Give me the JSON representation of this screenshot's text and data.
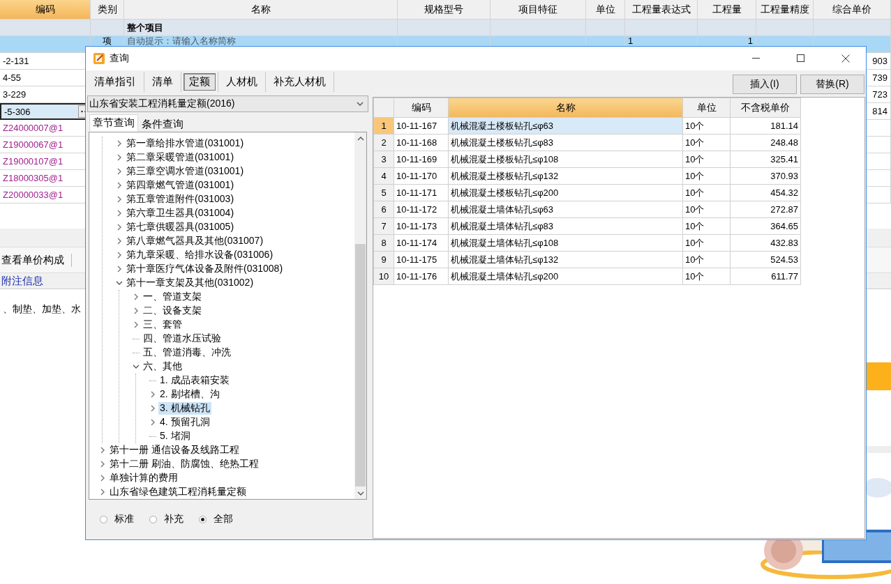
{
  "sheet": {
    "columns": [
      {
        "label": "编码",
        "selected": true
      },
      {
        "label": "类别",
        "selected": false
      },
      {
        "label": "名称",
        "selected": false
      },
      {
        "label": "规格型号",
        "selected": false
      },
      {
        "label": "项目特征",
        "selected": false
      },
      {
        "label": "单位",
        "selected": false
      },
      {
        "label": "工程量表达式",
        "selected": false
      },
      {
        "label": "工程量",
        "selected": false
      },
      {
        "label": "工程量精度",
        "selected": false
      },
      {
        "label": "综合单价",
        "selected": false
      }
    ],
    "summary_row": {
      "name": "整个项目"
    },
    "current_row": {
      "category": "项",
      "name_hint": "自动提示：请输入名称简称",
      "expression": "1",
      "quantity": "1"
    },
    "rows": [
      {
        "code": "-2-131",
        "price": "903",
        "kind": "quota",
        "selected": false
      },
      {
        "code": "4-55",
        "price": "739",
        "kind": "quota",
        "selected": false
      },
      {
        "code": "3-229",
        "price": "723",
        "kind": "quota",
        "selected": false
      },
      {
        "code": "-5-306",
        "price": "814",
        "kind": "quota",
        "selected": true
      },
      {
        "code": "Z24000007@1",
        "kind": "material",
        "selected": false
      },
      {
        "code": "Z19000067@1",
        "kind": "material",
        "selected": false
      },
      {
        "code": "Z19000107@1",
        "kind": "material",
        "selected": false
      },
      {
        "code": "Z18000305@1",
        "kind": "material",
        "selected": false
      },
      {
        "code": "Z20000033@1",
        "kind": "material",
        "selected": false
      }
    ],
    "toolbar": [
      "查看单价构成"
    ],
    "notes_tab": "附注信息",
    "notes_text": "、制垫、加垫、水"
  },
  "dialog": {
    "title": "查询",
    "tabs": [
      {
        "label": "清单指引",
        "selected": false
      },
      {
        "label": "清单",
        "selected": false
      },
      {
        "label": "定额",
        "selected": true
      },
      {
        "label": "人材机",
        "selected": false
      },
      {
        "label": "补充人材机",
        "selected": false
      }
    ],
    "buttons": [
      "插入(I)",
      "替换(R)"
    ],
    "library": "山东省安装工程消耗量定额(2016)",
    "search_tabs": [
      {
        "label": "章节查询",
        "selected": true
      },
      {
        "label": "条件查询",
        "selected": false
      }
    ],
    "tree": {
      "continued": [
        {
          "label": "第一章给排水管道(031001)",
          "kind": "branch",
          "expanded": false,
          "selected": false
        },
        {
          "label": "第二章采暖管道(031001)",
          "kind": "branch",
          "expanded": false,
          "selected": false
        },
        {
          "label": "第三章空调水管道(031001)",
          "kind": "branch",
          "expanded": false,
          "selected": false
        },
        {
          "label": "第四章燃气管道(031001)",
          "kind": "branch",
          "expanded": false,
          "selected": false
        },
        {
          "label": "第五章管道附件(031003)",
          "kind": "branch",
          "expanded": false,
          "selected": false
        },
        {
          "label": "第六章卫生器具(031004)",
          "kind": "branch",
          "expanded": false,
          "selected": false
        },
        {
          "label": "第七章供暖器具(031005)",
          "kind": "branch",
          "expanded": false,
          "selected": false
        },
        {
          "label": "第八章燃气器具及其他(031007)",
          "kind": "branch",
          "expanded": false,
          "selected": false
        },
        {
          "label": "第九章采暖、给排水设备(031006)",
          "kind": "branch",
          "expanded": false,
          "selected": false
        },
        {
          "label": "第十章医疗气体设备及附件(031008)",
          "kind": "branch",
          "expanded": false,
          "selected": false
        },
        {
          "label": "第十一章支架及其他(031002)",
          "kind": "branch",
          "expanded": true,
          "selected": false,
          "children": [
            {
              "label": "一、管道支架",
              "kind": "branch",
              "expanded": false,
              "selected": false
            },
            {
              "label": "二、设备支架",
              "kind": "branch",
              "expanded": false,
              "selected": false
            },
            {
              "label": "三、套管",
              "kind": "branch",
              "expanded": false,
              "selected": false
            },
            {
              "label": "四、管道水压试验",
              "kind": "leaf",
              "selected": false
            },
            {
              "label": "五、管道消毒、冲洗",
              "kind": "leaf",
              "selected": false
            },
            {
              "label": "六、其他",
              "kind": "branch",
              "expanded": true,
              "selected": false,
              "children": [
                {
                  "label": "1. 成品表箱安装",
                  "kind": "leaf",
                  "selected": false
                },
                {
                  "label": "2. 剔堵槽、沟",
                  "kind": "branch",
                  "expanded": false,
                  "selected": false
                },
                {
                  "label": "3. 机械钻孔",
                  "kind": "branch",
                  "expanded": false,
                  "selected": true
                },
                {
                  "label": "4. 预留孔洞",
                  "kind": "branch",
                  "expanded": false,
                  "selected": false
                },
                {
                  "label": "5. 堵洞",
                  "kind": "leaf",
                  "selected": false
                }
              ]
            }
          ]
        }
      ],
      "items": [
        {
          "label": "第十一册 通信设备及线路工程",
          "kind": "branch",
          "expanded": false,
          "selected": false
        },
        {
          "label": "第十二册 刷油、防腐蚀、绝热工程",
          "kind": "branch",
          "expanded": false,
          "selected": false
        },
        {
          "label": "单独计算的费用",
          "kind": "branch",
          "expanded": false,
          "selected": false
        },
        {
          "label": "山东省绿色建筑工程消耗量定额",
          "kind": "branch",
          "expanded": false,
          "selected": false
        }
      ]
    },
    "filters": [
      {
        "label": "标准",
        "selected": false
      },
      {
        "label": "补充",
        "selected": false
      },
      {
        "label": "全部",
        "selected": true
      }
    ],
    "table": {
      "columns": [
        {
          "label": "编码",
          "selected": false
        },
        {
          "label": "名称",
          "selected": true
        },
        {
          "label": "单位",
          "selected": false
        },
        {
          "label": "不含税单价",
          "selected": false
        }
      ],
      "rows": [
        {
          "index": "1",
          "code": "10-11-167",
          "name": "机械混凝土楼板钻孔≤φ63",
          "unit": "10个",
          "price": "181.14",
          "selected": true
        },
        {
          "index": "2",
          "code": "10-11-168",
          "name": "机械混凝土楼板钻孔≤φ83",
          "unit": "10个",
          "price": "248.48",
          "selected": false
        },
        {
          "index": "3",
          "code": "10-11-169",
          "name": "机械混凝土楼板钻孔≤φ108",
          "unit": "10个",
          "price": "325.41",
          "selected": false
        },
        {
          "index": "4",
          "code": "10-11-170",
          "name": "机械混凝土楼板钻孔≤φ132",
          "unit": "10个",
          "price": "370.93",
          "selected": false
        },
        {
          "index": "5",
          "code": "10-11-171",
          "name": "机械混凝土楼板钻孔≤φ200",
          "unit": "10个",
          "price": "454.32",
          "selected": false
        },
        {
          "index": "6",
          "code": "10-11-172",
          "name": "机械混凝土墙体钻孔≤φ63",
          "unit": "10个",
          "price": "272.87",
          "selected": false
        },
        {
          "index": "7",
          "code": "10-11-173",
          "name": "机械混凝土墙体钻孔≤φ83",
          "unit": "10个",
          "price": "364.65",
          "selected": false
        },
        {
          "index": "8",
          "code": "10-11-174",
          "name": "机械混凝土墙体钻孔≤φ108",
          "unit": "10个",
          "price": "432.83",
          "selected": false
        },
        {
          "index": "9",
          "code": "10-11-175",
          "name": "机械混凝土墙体钻孔≤φ132",
          "unit": "10个",
          "price": "524.53",
          "selected": false
        },
        {
          "index": "10",
          "code": "10-11-176",
          "name": "机械混凝土墙体钻孔≤φ200",
          "unit": "10个",
          "price": "611.77",
          "selected": false
        }
      ]
    }
  }
}
